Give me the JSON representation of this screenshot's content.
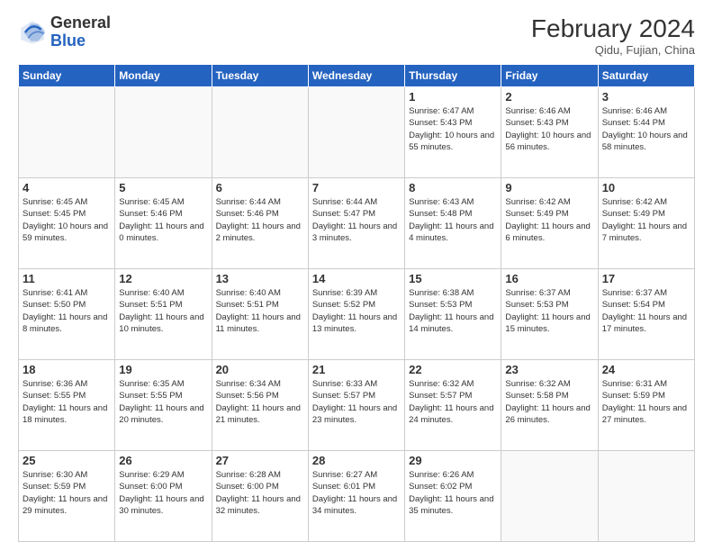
{
  "logo": {
    "general": "General",
    "blue": "Blue"
  },
  "header": {
    "month_year": "February 2024",
    "location": "Qidu, Fujian, China"
  },
  "days_of_week": [
    "Sunday",
    "Monday",
    "Tuesday",
    "Wednesday",
    "Thursday",
    "Friday",
    "Saturday"
  ],
  "weeks": [
    [
      {
        "day": null,
        "info": null
      },
      {
        "day": null,
        "info": null
      },
      {
        "day": null,
        "info": null
      },
      {
        "day": null,
        "info": null
      },
      {
        "day": "1",
        "info": "Sunrise: 6:47 AM\nSunset: 5:43 PM\nDaylight: 10 hours and 55 minutes."
      },
      {
        "day": "2",
        "info": "Sunrise: 6:46 AM\nSunset: 5:43 PM\nDaylight: 10 hours and 56 minutes."
      },
      {
        "day": "3",
        "info": "Sunrise: 6:46 AM\nSunset: 5:44 PM\nDaylight: 10 hours and 58 minutes."
      }
    ],
    [
      {
        "day": "4",
        "info": "Sunrise: 6:45 AM\nSunset: 5:45 PM\nDaylight: 10 hours and 59 minutes."
      },
      {
        "day": "5",
        "info": "Sunrise: 6:45 AM\nSunset: 5:46 PM\nDaylight: 11 hours and 0 minutes."
      },
      {
        "day": "6",
        "info": "Sunrise: 6:44 AM\nSunset: 5:46 PM\nDaylight: 11 hours and 2 minutes."
      },
      {
        "day": "7",
        "info": "Sunrise: 6:44 AM\nSunset: 5:47 PM\nDaylight: 11 hours and 3 minutes."
      },
      {
        "day": "8",
        "info": "Sunrise: 6:43 AM\nSunset: 5:48 PM\nDaylight: 11 hours and 4 minutes."
      },
      {
        "day": "9",
        "info": "Sunrise: 6:42 AM\nSunset: 5:49 PM\nDaylight: 11 hours and 6 minutes."
      },
      {
        "day": "10",
        "info": "Sunrise: 6:42 AM\nSunset: 5:49 PM\nDaylight: 11 hours and 7 minutes."
      }
    ],
    [
      {
        "day": "11",
        "info": "Sunrise: 6:41 AM\nSunset: 5:50 PM\nDaylight: 11 hours and 8 minutes."
      },
      {
        "day": "12",
        "info": "Sunrise: 6:40 AM\nSunset: 5:51 PM\nDaylight: 11 hours and 10 minutes."
      },
      {
        "day": "13",
        "info": "Sunrise: 6:40 AM\nSunset: 5:51 PM\nDaylight: 11 hours and 11 minutes."
      },
      {
        "day": "14",
        "info": "Sunrise: 6:39 AM\nSunset: 5:52 PM\nDaylight: 11 hours and 13 minutes."
      },
      {
        "day": "15",
        "info": "Sunrise: 6:38 AM\nSunset: 5:53 PM\nDaylight: 11 hours and 14 minutes."
      },
      {
        "day": "16",
        "info": "Sunrise: 6:37 AM\nSunset: 5:53 PM\nDaylight: 11 hours and 15 minutes."
      },
      {
        "day": "17",
        "info": "Sunrise: 6:37 AM\nSunset: 5:54 PM\nDaylight: 11 hours and 17 minutes."
      }
    ],
    [
      {
        "day": "18",
        "info": "Sunrise: 6:36 AM\nSunset: 5:55 PM\nDaylight: 11 hours and 18 minutes."
      },
      {
        "day": "19",
        "info": "Sunrise: 6:35 AM\nSunset: 5:55 PM\nDaylight: 11 hours and 20 minutes."
      },
      {
        "day": "20",
        "info": "Sunrise: 6:34 AM\nSunset: 5:56 PM\nDaylight: 11 hours and 21 minutes."
      },
      {
        "day": "21",
        "info": "Sunrise: 6:33 AM\nSunset: 5:57 PM\nDaylight: 11 hours and 23 minutes."
      },
      {
        "day": "22",
        "info": "Sunrise: 6:32 AM\nSunset: 5:57 PM\nDaylight: 11 hours and 24 minutes."
      },
      {
        "day": "23",
        "info": "Sunrise: 6:32 AM\nSunset: 5:58 PM\nDaylight: 11 hours and 26 minutes."
      },
      {
        "day": "24",
        "info": "Sunrise: 6:31 AM\nSunset: 5:59 PM\nDaylight: 11 hours and 27 minutes."
      }
    ],
    [
      {
        "day": "25",
        "info": "Sunrise: 6:30 AM\nSunset: 5:59 PM\nDaylight: 11 hours and 29 minutes."
      },
      {
        "day": "26",
        "info": "Sunrise: 6:29 AM\nSunset: 6:00 PM\nDaylight: 11 hours and 30 minutes."
      },
      {
        "day": "27",
        "info": "Sunrise: 6:28 AM\nSunset: 6:00 PM\nDaylight: 11 hours and 32 minutes."
      },
      {
        "day": "28",
        "info": "Sunrise: 6:27 AM\nSunset: 6:01 PM\nDaylight: 11 hours and 34 minutes."
      },
      {
        "day": "29",
        "info": "Sunrise: 6:26 AM\nSunset: 6:02 PM\nDaylight: 11 hours and 35 minutes."
      },
      {
        "day": null,
        "info": null
      },
      {
        "day": null,
        "info": null
      }
    ]
  ]
}
